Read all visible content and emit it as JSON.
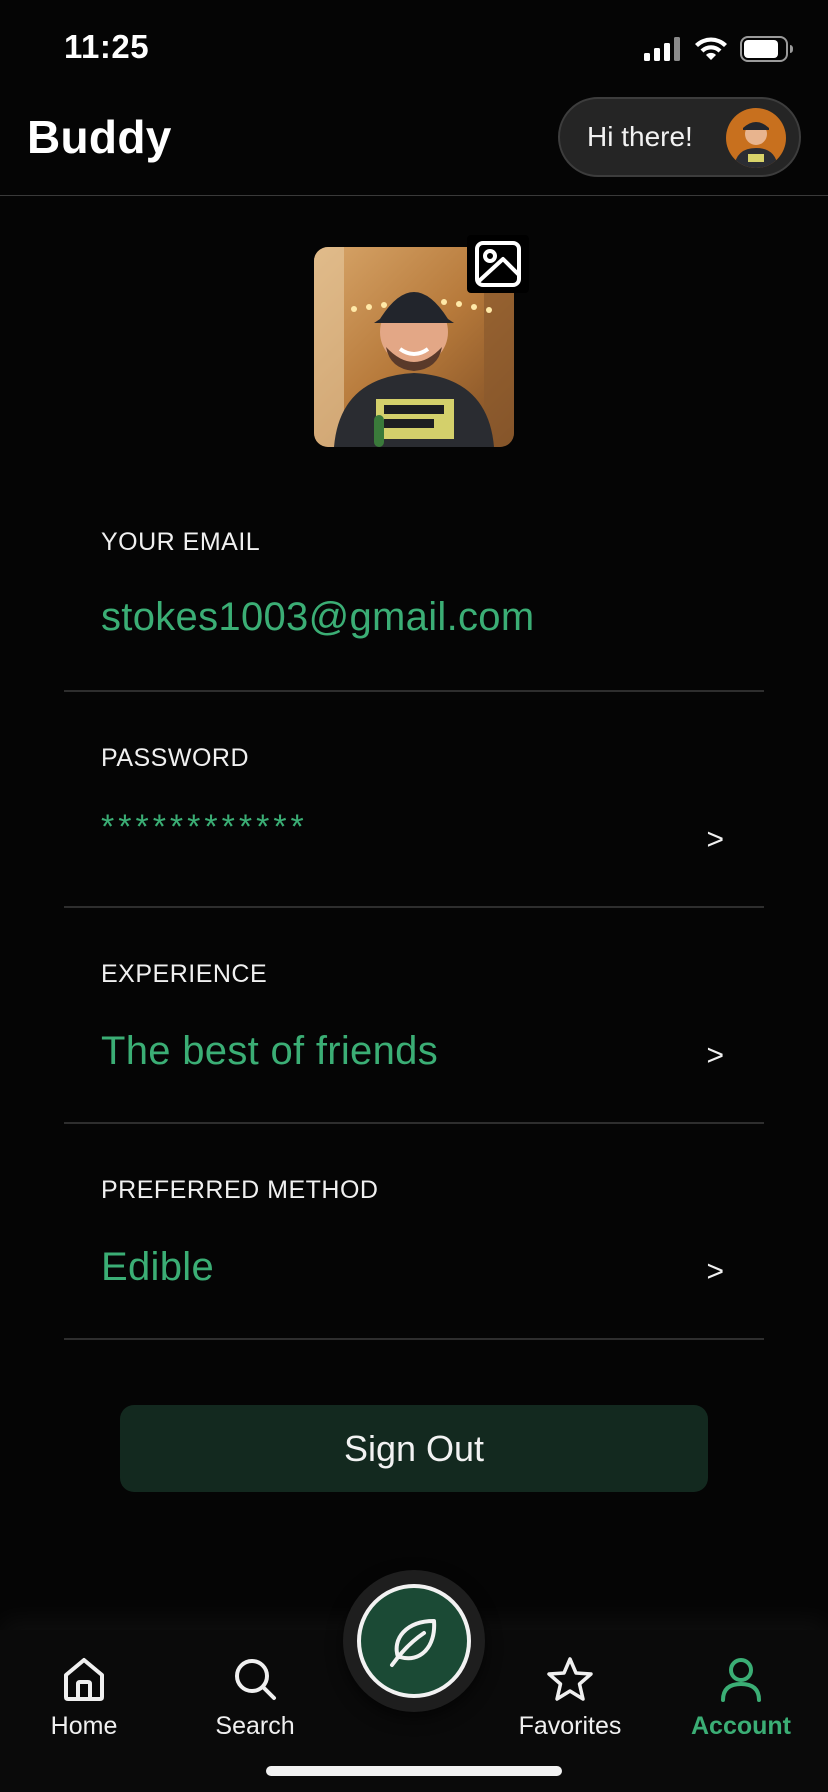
{
  "status_bar": {
    "time": "11:25",
    "icons": [
      "cellular-signal-icon",
      "wifi-icon",
      "battery-icon"
    ]
  },
  "header": {
    "title": "Buddy",
    "greeting": "Hi there!"
  },
  "profile": {
    "edit_icon": "image-icon"
  },
  "fields": [
    {
      "label": "YOUR EMAIL",
      "value": "stokes1003@gmail.com",
      "chevron": ""
    },
    {
      "label": "PASSWORD",
      "value": "************",
      "chevron": ">"
    },
    {
      "label": "EXPERIENCE",
      "value": "The best of friends",
      "chevron": ">"
    },
    {
      "label": "PREFERRED METHOD",
      "value": "Edible",
      "chevron": ">"
    }
  ],
  "actions": {
    "sign_out": "Sign Out"
  },
  "tabs": [
    {
      "label": "Home",
      "icon": "home-icon",
      "active": false
    },
    {
      "label": "Search",
      "icon": "search-icon",
      "active": false
    },
    {
      "label": "",
      "icon": "leaf-icon",
      "active": false
    },
    {
      "label": "Favorites",
      "icon": "star-icon",
      "active": false
    },
    {
      "label": "Account",
      "icon": "user-icon",
      "active": true
    }
  ],
  "colors": {
    "accent": "#3bae75",
    "background": "#050505",
    "button_bg": "#13291f",
    "fab_bg": "#1b4a35"
  }
}
